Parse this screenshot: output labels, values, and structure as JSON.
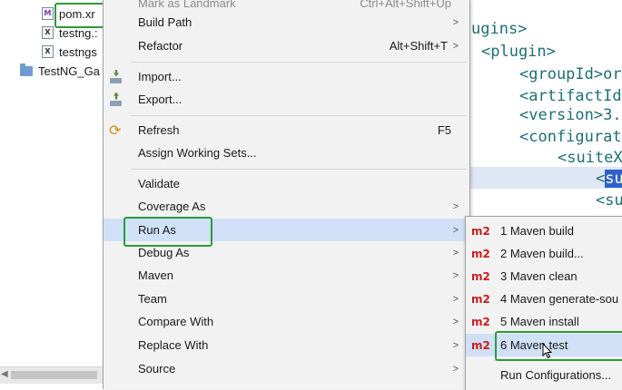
{
  "tree": {
    "items": [
      {
        "label": "pom.xr",
        "icon": "M"
      },
      {
        "label": "testng.:",
        "icon": "X"
      },
      {
        "label": "testngs",
        "icon": "X"
      },
      {
        "label": "TestNG_Ga",
        "icon": "project"
      }
    ]
  },
  "editor": {
    "lines": [
      "ugins>",
      "<plugin>",
      "<groupId>or",
      "<artifactId",
      "<version>3.",
      "<configurat",
      "<suiteX",
      "<",
      "su",
      "<su"
    ]
  },
  "context_menu": {
    "items": [
      {
        "label": "Mark as Landmark",
        "shortcut": "Ctrl+Alt+Shift+Up"
      },
      {
        "label": "Build Path"
      },
      {
        "label": "Refactor",
        "shortcut": "Alt+Shift+T"
      },
      {
        "label": "Import..."
      },
      {
        "label": "Export..."
      },
      {
        "label": "Refresh",
        "shortcut": "F5"
      },
      {
        "label": "Assign Working Sets..."
      },
      {
        "label": "Validate"
      },
      {
        "label": "Coverage As"
      },
      {
        "label": "Run As"
      },
      {
        "label": "Debug As"
      },
      {
        "label": "Maven"
      },
      {
        "label": "Team"
      },
      {
        "label": "Compare With"
      },
      {
        "label": "Replace With"
      },
      {
        "label": "Source"
      }
    ],
    "submenu_arrow": ">"
  },
  "run_as_submenu": {
    "badge": "m2",
    "items": [
      {
        "label": "1 Maven build"
      },
      {
        "label": "2 Maven build..."
      },
      {
        "label": "3 Maven clean"
      },
      {
        "label": "4 Maven generate-sou"
      },
      {
        "label": "5 Maven install"
      },
      {
        "label": "6 Maven test"
      },
      {
        "label": "Run Configurations..."
      }
    ]
  },
  "colors": {
    "highlight_box": "#2c9a3c",
    "menu_selection": "#cfe0f7",
    "m2_badge": "#c81e1e",
    "xml_tag": "#1f6e73"
  }
}
